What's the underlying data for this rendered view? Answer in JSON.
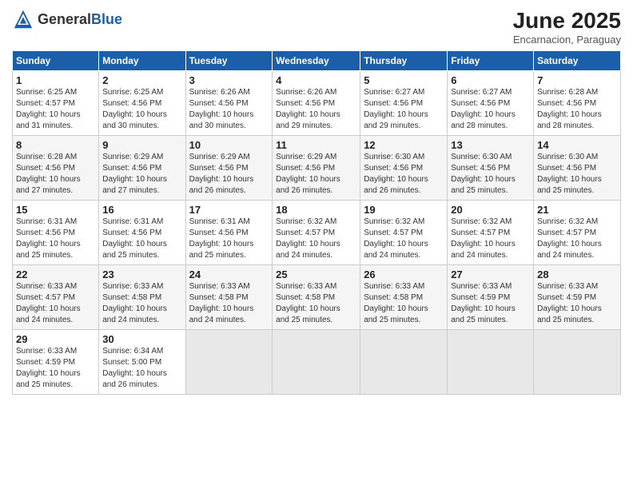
{
  "header": {
    "logo_general": "General",
    "logo_blue": "Blue",
    "month_title": "June 2025",
    "subtitle": "Encarnacion, Paraguay"
  },
  "weekdays": [
    "Sunday",
    "Monday",
    "Tuesday",
    "Wednesday",
    "Thursday",
    "Friday",
    "Saturday"
  ],
  "weeks": [
    [
      {
        "day": "1",
        "info": "Sunrise: 6:25 AM\nSunset: 4:57 PM\nDaylight: 10 hours\nand 31 minutes."
      },
      {
        "day": "2",
        "info": "Sunrise: 6:25 AM\nSunset: 4:56 PM\nDaylight: 10 hours\nand 30 minutes."
      },
      {
        "day": "3",
        "info": "Sunrise: 6:26 AM\nSunset: 4:56 PM\nDaylight: 10 hours\nand 30 minutes."
      },
      {
        "day": "4",
        "info": "Sunrise: 6:26 AM\nSunset: 4:56 PM\nDaylight: 10 hours\nand 29 minutes."
      },
      {
        "day": "5",
        "info": "Sunrise: 6:27 AM\nSunset: 4:56 PM\nDaylight: 10 hours\nand 29 minutes."
      },
      {
        "day": "6",
        "info": "Sunrise: 6:27 AM\nSunset: 4:56 PM\nDaylight: 10 hours\nand 28 minutes."
      },
      {
        "day": "7",
        "info": "Sunrise: 6:28 AM\nSunset: 4:56 PM\nDaylight: 10 hours\nand 28 minutes."
      }
    ],
    [
      {
        "day": "8",
        "info": "Sunrise: 6:28 AM\nSunset: 4:56 PM\nDaylight: 10 hours\nand 27 minutes."
      },
      {
        "day": "9",
        "info": "Sunrise: 6:29 AM\nSunset: 4:56 PM\nDaylight: 10 hours\nand 27 minutes."
      },
      {
        "day": "10",
        "info": "Sunrise: 6:29 AM\nSunset: 4:56 PM\nDaylight: 10 hours\nand 26 minutes."
      },
      {
        "day": "11",
        "info": "Sunrise: 6:29 AM\nSunset: 4:56 PM\nDaylight: 10 hours\nand 26 minutes."
      },
      {
        "day": "12",
        "info": "Sunrise: 6:30 AM\nSunset: 4:56 PM\nDaylight: 10 hours\nand 26 minutes."
      },
      {
        "day": "13",
        "info": "Sunrise: 6:30 AM\nSunset: 4:56 PM\nDaylight: 10 hours\nand 25 minutes."
      },
      {
        "day": "14",
        "info": "Sunrise: 6:30 AM\nSunset: 4:56 PM\nDaylight: 10 hours\nand 25 minutes."
      }
    ],
    [
      {
        "day": "15",
        "info": "Sunrise: 6:31 AM\nSunset: 4:56 PM\nDaylight: 10 hours\nand 25 minutes."
      },
      {
        "day": "16",
        "info": "Sunrise: 6:31 AM\nSunset: 4:56 PM\nDaylight: 10 hours\nand 25 minutes."
      },
      {
        "day": "17",
        "info": "Sunrise: 6:31 AM\nSunset: 4:56 PM\nDaylight: 10 hours\nand 25 minutes."
      },
      {
        "day": "18",
        "info": "Sunrise: 6:32 AM\nSunset: 4:57 PM\nDaylight: 10 hours\nand 24 minutes."
      },
      {
        "day": "19",
        "info": "Sunrise: 6:32 AM\nSunset: 4:57 PM\nDaylight: 10 hours\nand 24 minutes."
      },
      {
        "day": "20",
        "info": "Sunrise: 6:32 AM\nSunset: 4:57 PM\nDaylight: 10 hours\nand 24 minutes."
      },
      {
        "day": "21",
        "info": "Sunrise: 6:32 AM\nSunset: 4:57 PM\nDaylight: 10 hours\nand 24 minutes."
      }
    ],
    [
      {
        "day": "22",
        "info": "Sunrise: 6:33 AM\nSunset: 4:57 PM\nDaylight: 10 hours\nand 24 minutes."
      },
      {
        "day": "23",
        "info": "Sunrise: 6:33 AM\nSunset: 4:58 PM\nDaylight: 10 hours\nand 24 minutes."
      },
      {
        "day": "24",
        "info": "Sunrise: 6:33 AM\nSunset: 4:58 PM\nDaylight: 10 hours\nand 24 minutes."
      },
      {
        "day": "25",
        "info": "Sunrise: 6:33 AM\nSunset: 4:58 PM\nDaylight: 10 hours\nand 25 minutes."
      },
      {
        "day": "26",
        "info": "Sunrise: 6:33 AM\nSunset: 4:58 PM\nDaylight: 10 hours\nand 25 minutes."
      },
      {
        "day": "27",
        "info": "Sunrise: 6:33 AM\nSunset: 4:59 PM\nDaylight: 10 hours\nand 25 minutes."
      },
      {
        "day": "28",
        "info": "Sunrise: 6:33 AM\nSunset: 4:59 PM\nDaylight: 10 hours\nand 25 minutes."
      }
    ],
    [
      {
        "day": "29",
        "info": "Sunrise: 6:33 AM\nSunset: 4:59 PM\nDaylight: 10 hours\nand 25 minutes."
      },
      {
        "day": "30",
        "info": "Sunrise: 6:34 AM\nSunset: 5:00 PM\nDaylight: 10 hours\nand 26 minutes."
      },
      {
        "day": "",
        "info": ""
      },
      {
        "day": "",
        "info": ""
      },
      {
        "day": "",
        "info": ""
      },
      {
        "day": "",
        "info": ""
      },
      {
        "day": "",
        "info": ""
      }
    ]
  ]
}
